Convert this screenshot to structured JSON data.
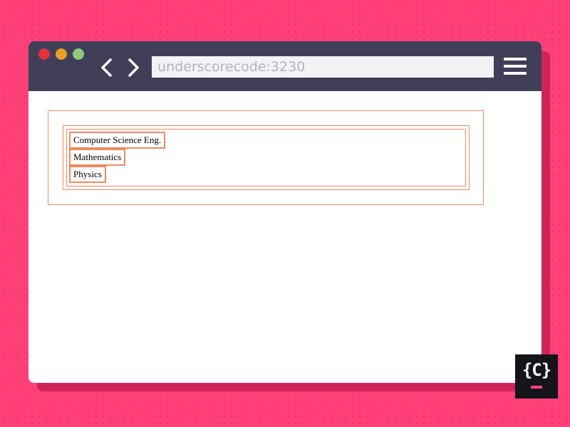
{
  "browser": {
    "window_controls": {
      "close_color": "#e5303e",
      "minimize_color": "#e8a026",
      "maximize_color": "#8ec97e"
    },
    "nav": {
      "back_icon": "chevron-left-icon",
      "forward_icon": "chevron-right-icon"
    },
    "address": "underscorecode:3230",
    "menu_icon": "hamburger-menu-icon"
  },
  "page": {
    "list_items": [
      "Computer Science Eng.",
      "Mathematics",
      "Physics"
    ],
    "outline_color": "#f0895d"
  },
  "brand": {
    "logo_icon": "curly-braces-c-logo-icon",
    "background": "#ff4079"
  }
}
